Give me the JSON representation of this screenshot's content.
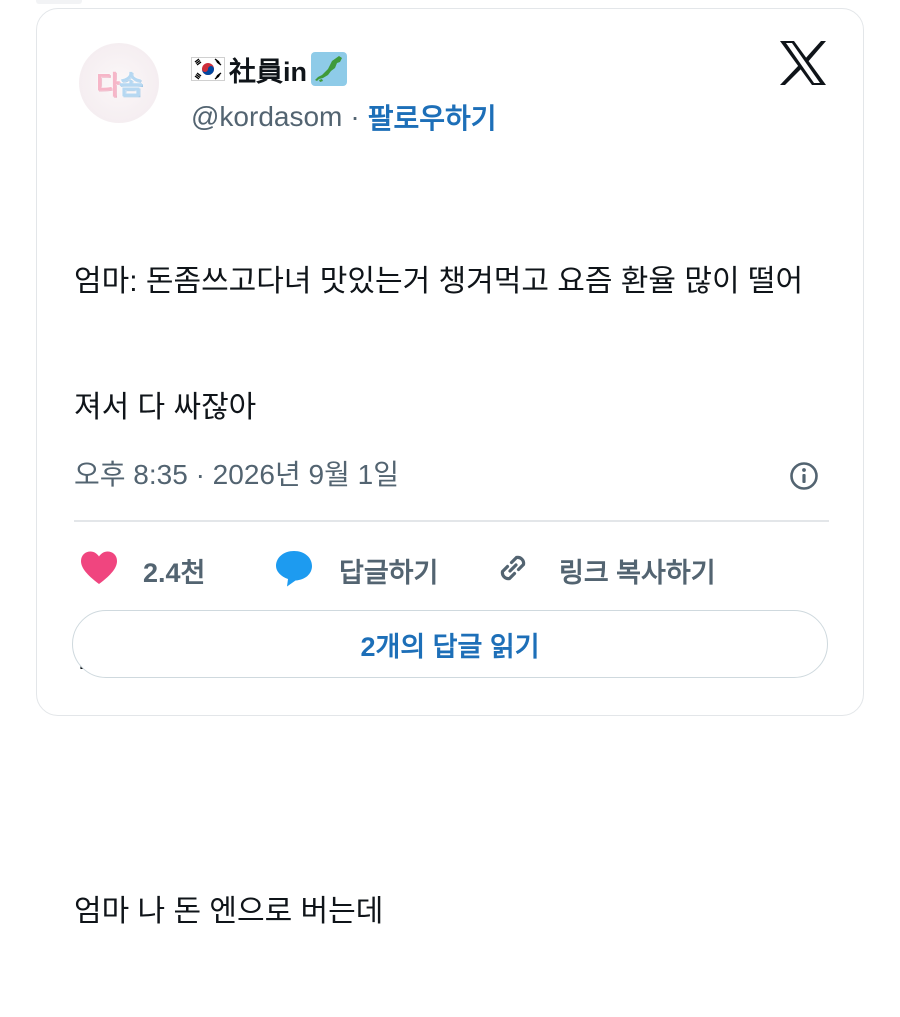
{
  "post": {
    "avatar_text": "다솜",
    "display_name": "社員in",
    "handle": "@kordasom",
    "separator": "·",
    "follow_label": "팔로우하기",
    "body_lines": [
      "엄마: 돈좀쓰고다녀 맛있는거 챙겨먹고 요즘 환율 많이 떨어",
      "져서 다 싸잖아",
      "",
      "??????????",
      "",
      "엄마 나 돈 엔으로 버는데"
    ],
    "timestamp": "오후 8:35 · 2026년 9월 1일"
  },
  "actions": {
    "like_count": "2.4천",
    "reply_label": "답글하기",
    "copy_link_label": "링크 복사하기"
  },
  "read_replies_label": "2개의 답글 읽기",
  "colors": {
    "link_blue": "#1d6fb8",
    "heart_pink": "#f0457f",
    "reply_blue": "#1d9bf0",
    "muted_text": "#536471"
  },
  "icons": [
    "south-korea-flag-icon",
    "japan-map-icon",
    "x-logo-icon",
    "info-icon",
    "heart-icon",
    "reply-bubble-icon",
    "link-icon"
  ]
}
